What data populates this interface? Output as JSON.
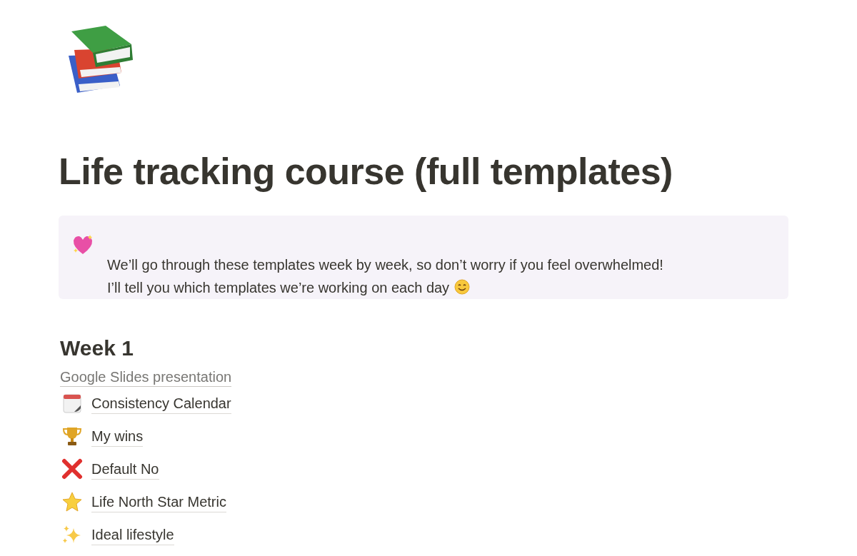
{
  "title": "Life tracking course (full templates)",
  "callout": {
    "text": "We’ll go through these templates week by week, so don’t worry if you feel overwhelmed! I’ll tell you which templates we’re working on each day"
  },
  "heading": "Week 1",
  "web_link": "Google Slides presentation",
  "pages": [
    {
      "kind": "calendar",
      "label": "Consistency Calendar"
    },
    {
      "kind": "trophy",
      "label": "My wins"
    },
    {
      "kind": "cross",
      "label": "Default No"
    },
    {
      "kind": "star",
      "label": "Life North Star Metric"
    },
    {
      "kind": "sparkles",
      "label": "Ideal lifestyle"
    }
  ]
}
